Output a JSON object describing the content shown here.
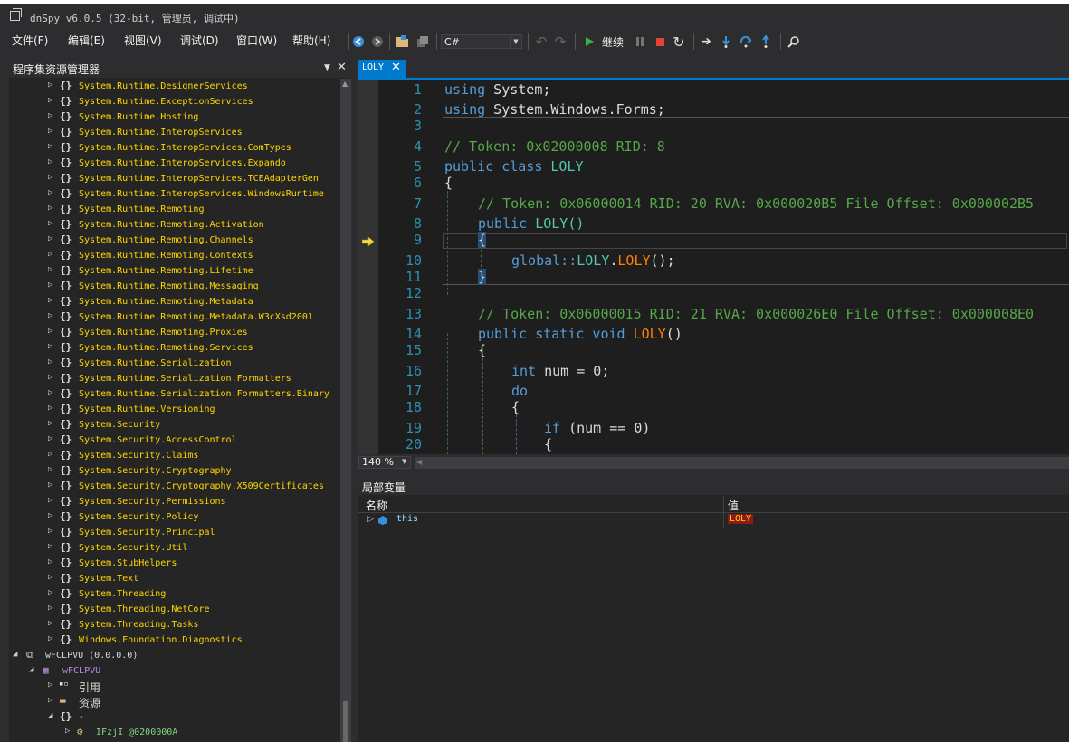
{
  "window": {
    "title": "dnSpy v6.0.5 (32-bit, 管理员, 调试中)"
  },
  "menu": [
    "文件(F)",
    "编辑(E)",
    "视图(V)",
    "调试(D)",
    "窗口(W)",
    "帮助(H)"
  ],
  "toolbar": {
    "language": "C#",
    "continue_label": "继续"
  },
  "explorer": {
    "title": "程序集资源管理器",
    "namespaces": [
      "System.Runtime.DesignerServices",
      "System.Runtime.ExceptionServices",
      "System.Runtime.Hosting",
      "System.Runtime.InteropServices",
      "System.Runtime.InteropServices.ComTypes",
      "System.Runtime.InteropServices.Expando",
      "System.Runtime.InteropServices.TCEAdapterGen",
      "System.Runtime.InteropServices.WindowsRuntime",
      "System.Runtime.Remoting",
      "System.Runtime.Remoting.Activation",
      "System.Runtime.Remoting.Channels",
      "System.Runtime.Remoting.Contexts",
      "System.Runtime.Remoting.Lifetime",
      "System.Runtime.Remoting.Messaging",
      "System.Runtime.Remoting.Metadata",
      "System.Runtime.Remoting.Metadata.W3cXsd2001",
      "System.Runtime.Remoting.Proxies",
      "System.Runtime.Remoting.Services",
      "System.Runtime.Serialization",
      "System.Runtime.Serialization.Formatters",
      "System.Runtime.Serialization.Formatters.Binary",
      "System.Runtime.Versioning",
      "System.Security",
      "System.Security.AccessControl",
      "System.Security.Claims",
      "System.Security.Cryptography",
      "System.Security.Cryptography.X509Certificates",
      "System.Security.Permissions",
      "System.Security.Policy",
      "System.Security.Principal",
      "System.Security.Util",
      "System.StubHelpers",
      "System.Text",
      "System.Threading",
      "System.Threading.NetCore",
      "System.Threading.Tasks",
      "Windows.Foundation.Diagnostics"
    ],
    "assembly": "wFCLPVU (0.0.0.0)",
    "module": "wFCLPVU",
    "references": "引用",
    "resources": "资源",
    "root_namespace": "-",
    "type": "IFzjI @0200000A"
  },
  "editor": {
    "tab": "LOLY",
    "zoom": "140 %",
    "lines": {
      "l1_kw": "using",
      "l1_rest": " System;",
      "l2_kw": "using",
      "l2_rest": " System.Windows.Forms;",
      "l4": "// Token: 0x02000008 RID: 8",
      "l5_kw": "public class",
      "l5_ty": " LOLY",
      "l6": "{",
      "l7": "// Token: 0x06000014 RID: 20 RVA: 0x000020B5 File Offset: 0x000002B5",
      "l8_kw": "public",
      "l8_rest": " LOLY()",
      "l9": "{",
      "l10_a": "global::",
      "l10_b": "LOLY",
      "l10_c": ".",
      "l10_d": "LOLY",
      "l10_e": "();",
      "l11": "}",
      "l13": "// Token: 0x06000015 RID: 21 RVA: 0x000026E0 File Offset: 0x000008E0",
      "l14_kw": "public static void",
      "l14_mt": " LOLY",
      "l14_rest": "()",
      "l15": "{",
      "l16_kw": "int",
      "l16_rest": " num = 0;",
      "l17": "do",
      "l18": "{",
      "l19_kw": "if",
      "l19_rest": " (num == 0)",
      "l20": "{"
    },
    "line_numbers": [
      "1",
      "2",
      "3",
      "4",
      "5",
      "6",
      "7",
      "8",
      "9",
      "10",
      "11",
      "12",
      "13",
      "14",
      "15",
      "16",
      "17",
      "18",
      "19",
      "20"
    ]
  },
  "locals": {
    "title": "局部变量",
    "col_name": "名称",
    "col_value": "值",
    "var_name": "this",
    "var_value": "LOLY"
  }
}
